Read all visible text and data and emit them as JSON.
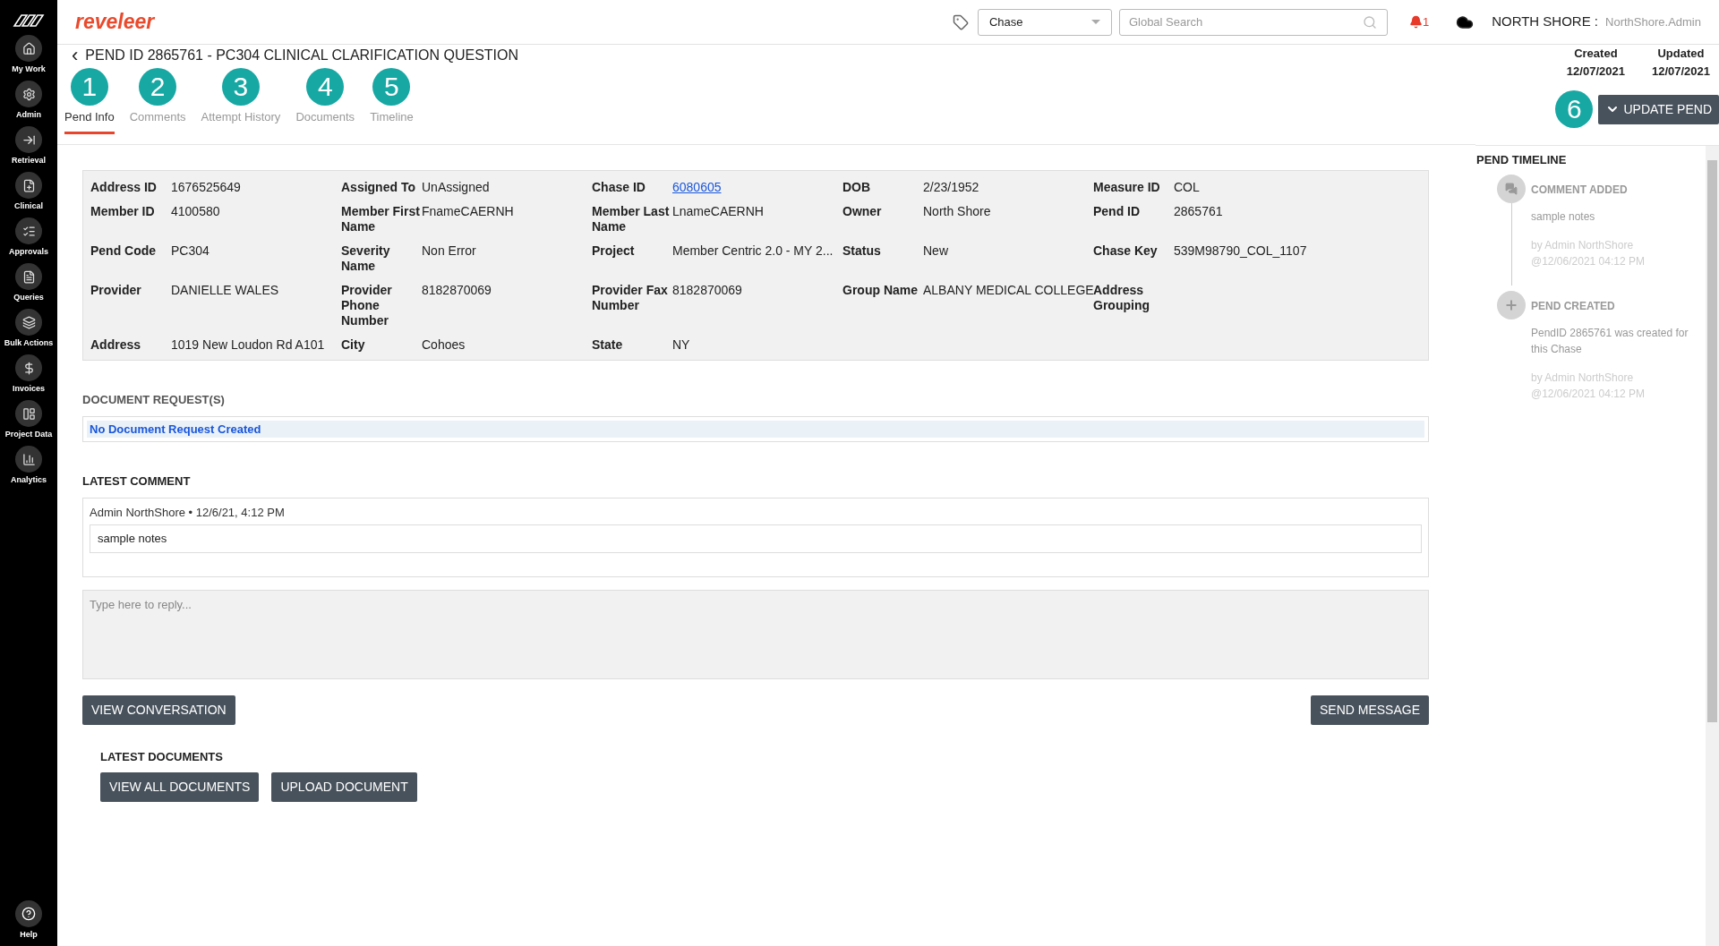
{
  "sidebar": {
    "items": [
      {
        "label": "My Work"
      },
      {
        "label": "Admin"
      },
      {
        "label": "Retrieval"
      },
      {
        "label": "Clinical"
      },
      {
        "label": "Approvals"
      },
      {
        "label": "Queries"
      },
      {
        "label": "Bulk Actions"
      },
      {
        "label": "Invoices"
      },
      {
        "label": "Project Data"
      },
      {
        "label": "Analytics"
      }
    ],
    "help": "Help"
  },
  "topbar": {
    "brand": "reveleer",
    "type_select": "Chase",
    "search": {
      "placeholder": "Global Search"
    },
    "notifications": "1",
    "org": "NORTH SHORE :",
    "user": "NorthShore.Admin"
  },
  "header": {
    "back": "‹",
    "title": "PEND ID 2865761 - PC304 CLINICAL CLARIFICATION QUESTION",
    "created_label": "Created",
    "created": "12/07/2021",
    "updated_label": "Updated",
    "updated": "12/07/2021",
    "update_button": "UPDATE PEND"
  },
  "tabs": [
    {
      "label": "Pend Info",
      "selected": true,
      "badge": "1"
    },
    {
      "label": "Comments",
      "selected": false,
      "badge": "2"
    },
    {
      "label": "Attempt History",
      "selected": false,
      "badge": "3"
    },
    {
      "label": "Documents",
      "selected": false,
      "badge": "4"
    },
    {
      "label": "Timeline",
      "selected": false,
      "badge": "5"
    }
  ],
  "update_badge": "6",
  "info": {
    "rows": [
      [
        {
          "label": "Address ID",
          "value": "1676525649"
        },
        {
          "label": "Assigned To",
          "value": "UnAssigned"
        },
        {
          "label": "Chase ID",
          "value": "6080605",
          "kind": "link"
        },
        {
          "label": "DOB",
          "value": "2/23/1952"
        },
        {
          "label": "Measure ID",
          "value": "COL"
        }
      ],
      [
        {
          "label": "Member ID",
          "value": "4100580"
        },
        {
          "label": "Member First Name",
          "value": "FnameCAERNH"
        },
        {
          "label": "Member Last Name",
          "value": "LnameCAERNH"
        },
        {
          "label": "Owner",
          "value": "North Shore"
        },
        {
          "label": "Pend ID",
          "value": "2865761"
        }
      ],
      [
        {
          "label": "Pend Code",
          "value": "PC304"
        },
        {
          "label": "Severity Name",
          "value": "Non Error"
        },
        {
          "label": "Project",
          "value": "Member Centric 2.0 - MY 2..."
        },
        {
          "label": "Status",
          "value": "New"
        },
        {
          "label": "Chase Key",
          "value": "539M98790_COL_1107"
        }
      ],
      [
        {
          "label": "Provider",
          "value": "DANIELLE WALES"
        },
        {
          "label": "Provider Phone Number",
          "value": "8182870069"
        },
        {
          "label": "Provider Fax Number",
          "value": "8182870069"
        },
        {
          "label": "Group Name",
          "value": "ALBANY MEDICAL COLLEGE"
        },
        {
          "label": "Address Grouping"
        }
      ],
      [
        {
          "label": "Address",
          "value": "1019 New Loudon Rd A101"
        },
        {
          "label": "City",
          "value": "Cohoes"
        },
        {
          "label": "State",
          "value": "NY"
        }
      ]
    ]
  },
  "document_requests": {
    "title": "DOCUMENT REQUEST(S)",
    "message": "No Document Request Created"
  },
  "latest_comment": {
    "title": "LATEST COMMENT",
    "author": "Admin NorthShore • 12/6/21, 4:12 PM",
    "text": "sample notes"
  },
  "reply": {
    "placeholder": "Type here to reply..."
  },
  "buttons": {
    "view_conversation": "VIEW CONVERSATION",
    "send_message": "SEND MESSAGE"
  },
  "latest_documents": {
    "title": "LATEST DOCUMENTS",
    "buttons": [
      "VIEW ALL DOCUMENTS",
      "UPLOAD DOCUMENT"
    ]
  },
  "timeline": {
    "title": "PEND TIMELINE",
    "events": [
      {
        "kind": "comment",
        "title": "COMMENT ADDED",
        "text": "sample notes",
        "by": "by Admin NorthShore",
        "at": "@12/06/2021 04:12 PM"
      },
      {
        "kind": "created",
        "title": "PEND CREATED",
        "text": "PendID 2865761 was created for this Chase",
        "by": "by Admin NorthShore",
        "at": "@12/06/2021 04:12 PM"
      }
    ]
  }
}
